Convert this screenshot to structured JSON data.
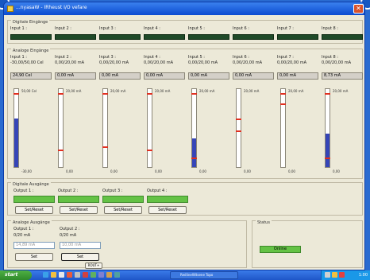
{
  "window": {
    "title": "...nyasaW - IRheust I/O vefare"
  },
  "digital_inputs": {
    "group_title": "Digitale Eingänge",
    "items": [
      {
        "label": "Input 1 :"
      },
      {
        "label": "Input 2 :"
      },
      {
        "label": "Input 3 :"
      },
      {
        "label": "Input 4 :"
      },
      {
        "label": "Input 5 :"
      },
      {
        "label": "Input 6 :"
      },
      {
        "label": "Input 7 :"
      },
      {
        "label": "Input 8 :"
      }
    ]
  },
  "analog_inputs": {
    "group_title": "Analoge Eingänge",
    "items": [
      {
        "label": "Input 1 :",
        "range": "-30,00/50,00 Cel",
        "value": "24,90 Cel",
        "scale_top": "50,00 Cel",
        "scale_bottom": "-30,00",
        "level": 0.62,
        "marker_levels": [
          0.93
        ]
      },
      {
        "label": "Input 2 :",
        "range": "0,00/20,00 mA",
        "value": "0,00 mA",
        "scale_top": "20,00 mA",
        "scale_bottom": "0,00",
        "level": 0,
        "marker_levels": [
          0.93,
          0.2
        ]
      },
      {
        "label": "Input 3 :",
        "range": "0,00/20,00 mA",
        "value": "0,00 mA",
        "scale_top": "20,00 mA",
        "scale_bottom": "0,00",
        "level": 0,
        "marker_levels": [
          0.93,
          0.24
        ]
      },
      {
        "label": "Input 4 :",
        "range": "0,00/20,00 mA",
        "value": "0,00 mA",
        "scale_top": "20,00 mA",
        "scale_bottom": "0,00",
        "level": 0,
        "marker_levels": [
          0.93,
          0.2
        ]
      },
      {
        "label": "Input 5 :",
        "range": "0,00/20,00 mA",
        "value": "0,00 mA",
        "scale_top": "20,00 mA",
        "scale_bottom": "0,00",
        "level": 0.37,
        "marker_levels": [
          0.93,
          0.1
        ]
      },
      {
        "label": "Input 6 :",
        "range": "0,00/20,00 mA",
        "value": "0,00 mA",
        "scale_top": "20,00 mA",
        "scale_bottom": "0,00",
        "level": 0,
        "marker_levels": [
          0.6,
          0.45
        ]
      },
      {
        "label": "Input 7 :",
        "range": "0,00/20,00 mA",
        "value": "0,00 mA",
        "scale_top": "20,00 mA",
        "scale_bottom": "0,00",
        "level": 0,
        "marker_levels": [
          0.93,
          0.8
        ]
      },
      {
        "label": "Input 8 :",
        "range": "0,00/20,00 mA",
        "value": "8,73 mA",
        "scale_top": "20,00 mA",
        "scale_bottom": "0,00",
        "level": 0.43,
        "marker_levels": [
          0.93,
          0.1
        ]
      }
    ]
  },
  "digital_outputs": {
    "group_title": "Digitale Ausgänge",
    "items": [
      {
        "label": "Output 1 :",
        "button": "Set/Reset"
      },
      {
        "label": "Output 2 :",
        "button": "Set/Reset"
      },
      {
        "label": "Output 3 :",
        "button": "Set/Reset"
      },
      {
        "label": "Output 4 :",
        "button": "Set/Reset"
      }
    ]
  },
  "analog_outputs": {
    "group_title": "Analoge Ausgänge",
    "items": [
      {
        "label": "Output 1 :",
        "range": "0/20 mA",
        "placeholder": "14,89 mA",
        "button": "Set"
      },
      {
        "label": "Output 2 :",
        "range": "0/20 mA",
        "placeholder": "10,00 mA",
        "button": "Set"
      }
    ],
    "stop_button": "ROUT+"
  },
  "status": {
    "group_title": "Status",
    "value": "Online"
  },
  "taskbar": {
    "start": "start",
    "task_label": "RedlineWitsene Topo",
    "clock": "1:00"
  },
  "colors": {
    "led_off": "#1f4a28",
    "led_on": "#64c245",
    "gauge_fill": "#3545b8",
    "marker": "#e03020"
  }
}
